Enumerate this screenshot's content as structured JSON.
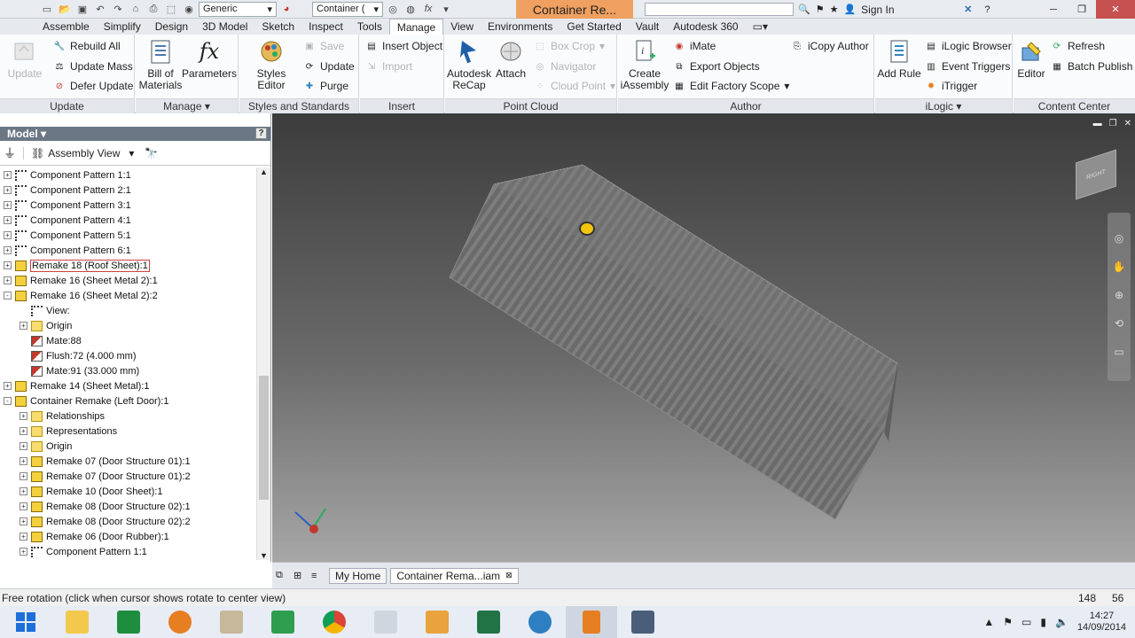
{
  "titlebar": {
    "style_combo": "Generic",
    "doc_combo": "Container (",
    "app_title": "Container Re...",
    "sign_in": "Sign In"
  },
  "tabs": [
    "Assemble",
    "Simplify",
    "Design",
    "3D Model",
    "Sketch",
    "Inspect",
    "Tools",
    "Manage",
    "View",
    "Environments",
    "Get Started",
    "Vault",
    "Autodesk 360"
  ],
  "active_tab": "Manage",
  "ribbon": {
    "update": {
      "label": "Update",
      "big": "Update",
      "rebuild": "Rebuild All",
      "mass": "Update Mass",
      "defer": "Defer Update"
    },
    "manage": {
      "label": "Manage",
      "bom": "Bill of Materials",
      "params": "Parameters"
    },
    "styles": {
      "label": "Styles and Standards",
      "editor": "Styles Editor",
      "save": "Save",
      "update": "Update",
      "purge": "Purge"
    },
    "insert": {
      "label": "Insert",
      "object": "Insert Object",
      "import": "Import"
    },
    "pointcloud": {
      "label": "Point Cloud",
      "recap": "Autodesk ReCap",
      "attach": "Attach",
      "boxcrop": "Box Crop",
      "navigator": "Navigator",
      "cloudpoint": "Cloud Point"
    },
    "author": {
      "label": "Author",
      "create": "Create iAssembly",
      "imate": "iMate",
      "export": "Export Objects",
      "factory": "Edit Factory Scope",
      "icopy": "iCopy Author"
    },
    "ilogic": {
      "label": "iLogic",
      "addrule": "Add Rule",
      "browser": "iLogic Browser",
      "triggers": "Event Triggers",
      "itrigger": "iTrigger"
    },
    "content": {
      "label": "Content Center",
      "editor": "Editor",
      "refresh": "Refresh",
      "batch": "Batch Publish"
    }
  },
  "browser": {
    "title": "Model",
    "view": "Assembly View",
    "rows": [
      {
        "indent": 0,
        "exp": "+",
        "icon": "pat",
        "text": "Component Pattern 1:1"
      },
      {
        "indent": 0,
        "exp": "+",
        "icon": "pat",
        "text": "Component Pattern 2:1"
      },
      {
        "indent": 0,
        "exp": "+",
        "icon": "pat",
        "text": "Component Pattern 3:1"
      },
      {
        "indent": 0,
        "exp": "+",
        "icon": "pat",
        "text": "Component Pattern 4:1"
      },
      {
        "indent": 0,
        "exp": "+",
        "icon": "pat",
        "text": "Component Pattern 5:1"
      },
      {
        "indent": 0,
        "exp": "+",
        "icon": "pat",
        "text": "Component Pattern 6:1"
      },
      {
        "indent": 0,
        "exp": "+",
        "icon": "asm",
        "text": "Remake 18 (Roof Sheet):1",
        "selected": true
      },
      {
        "indent": 0,
        "exp": "+",
        "icon": "asm",
        "text": "Remake 16 (Sheet Metal 2):1"
      },
      {
        "indent": 0,
        "exp": "-",
        "icon": "asm",
        "text": "Remake 16 (Sheet Metal 2):2"
      },
      {
        "indent": 1,
        "exp": "",
        "icon": "pat",
        "text": "View:"
      },
      {
        "indent": 1,
        "exp": "+",
        "icon": "fold",
        "text": "Origin"
      },
      {
        "indent": 1,
        "exp": "",
        "icon": "mate",
        "text": "Mate:88"
      },
      {
        "indent": 1,
        "exp": "",
        "icon": "mate",
        "text": "Flush:72 (4.000 mm)"
      },
      {
        "indent": 1,
        "exp": "",
        "icon": "mate",
        "text": "Mate:91 (33.000 mm)"
      },
      {
        "indent": 0,
        "exp": "+",
        "icon": "asm",
        "text": "Remake 14 (Sheet Metal):1"
      },
      {
        "indent": 0,
        "exp": "-",
        "icon": "asm",
        "text": "Container Remake (Left Door):1"
      },
      {
        "indent": 1,
        "exp": "+",
        "icon": "fold",
        "text": "Relationships"
      },
      {
        "indent": 1,
        "exp": "+",
        "icon": "fold",
        "text": "Representations"
      },
      {
        "indent": 1,
        "exp": "+",
        "icon": "fold",
        "text": "Origin"
      },
      {
        "indent": 1,
        "exp": "+",
        "icon": "asm",
        "text": "Remake 07 (Door Structure 01):1"
      },
      {
        "indent": 1,
        "exp": "+",
        "icon": "asm",
        "text": "Remake 07 (Door Structure 01):2"
      },
      {
        "indent": 1,
        "exp": "+",
        "icon": "asm",
        "text": "Remake 10 (Door Sheet):1"
      },
      {
        "indent": 1,
        "exp": "+",
        "icon": "asm",
        "text": "Remake 08 (Door Structure 02):1"
      },
      {
        "indent": 1,
        "exp": "+",
        "icon": "asm",
        "text": "Remake 08 (Door Structure 02):2"
      },
      {
        "indent": 1,
        "exp": "+",
        "icon": "asm",
        "text": "Remake 06 (Door Rubber):1"
      },
      {
        "indent": 1,
        "exp": "+",
        "icon": "pat",
        "text": "Component Pattern 1:1"
      }
    ]
  },
  "viewcube_label": "RIGHT",
  "doc_tabs": [
    "My Home",
    "Container Rema...iam"
  ],
  "status": {
    "message": "Free rotation (click when cursor shows rotate to center view)",
    "n1": "148",
    "n2": "56"
  },
  "taskbar": {
    "time": "14:27",
    "date": "14/09/2014"
  }
}
